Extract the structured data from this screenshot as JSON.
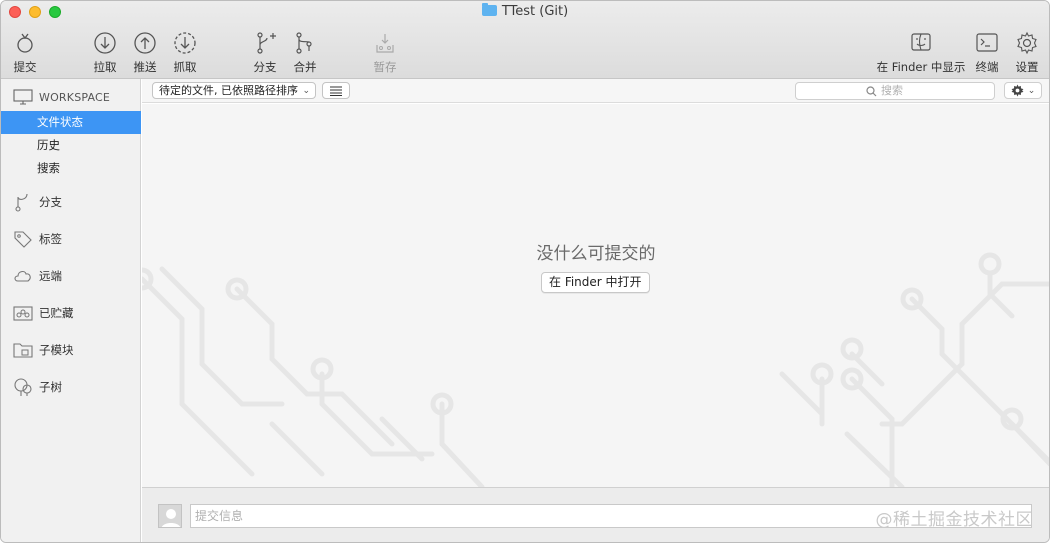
{
  "window": {
    "title": "TTest (Git)"
  },
  "toolbar": {
    "commit": "提交",
    "pull": "拉取",
    "push": "推送",
    "fetch": "抓取",
    "branch": "分支",
    "merge": "合并",
    "stash": "暂存",
    "show_in_finder": "在 Finder 中显示",
    "terminal": "终端",
    "settings": "设置"
  },
  "sidebar": {
    "workspace_header": "WORKSPACE",
    "workspace_items": [
      {
        "label": "文件状态",
        "selected": true
      },
      {
        "label": "历史",
        "selected": false
      },
      {
        "label": "搜索",
        "selected": false
      }
    ],
    "groups": [
      {
        "label": "分支",
        "icon": "branch-icon"
      },
      {
        "label": "标签",
        "icon": "tag-icon"
      },
      {
        "label": "远端",
        "icon": "cloud-icon"
      },
      {
        "label": "已贮藏",
        "icon": "stash-icon"
      },
      {
        "label": "子模块",
        "icon": "submodule-folder-icon"
      },
      {
        "label": "子树",
        "icon": "subtree-icon"
      }
    ]
  },
  "filterbar": {
    "sort_value": "待定的文件, 已依照路径排序",
    "search_placeholder": "搜索"
  },
  "main": {
    "empty_message": "没什么可提交的",
    "open_in_finder": "在 Finder 中打开"
  },
  "commit": {
    "message_placeholder": "提交信息"
  },
  "watermark": "@稀土掘金技术社区",
  "colors": {
    "selection": "#3d95f4",
    "background": "#f5f5f5"
  }
}
